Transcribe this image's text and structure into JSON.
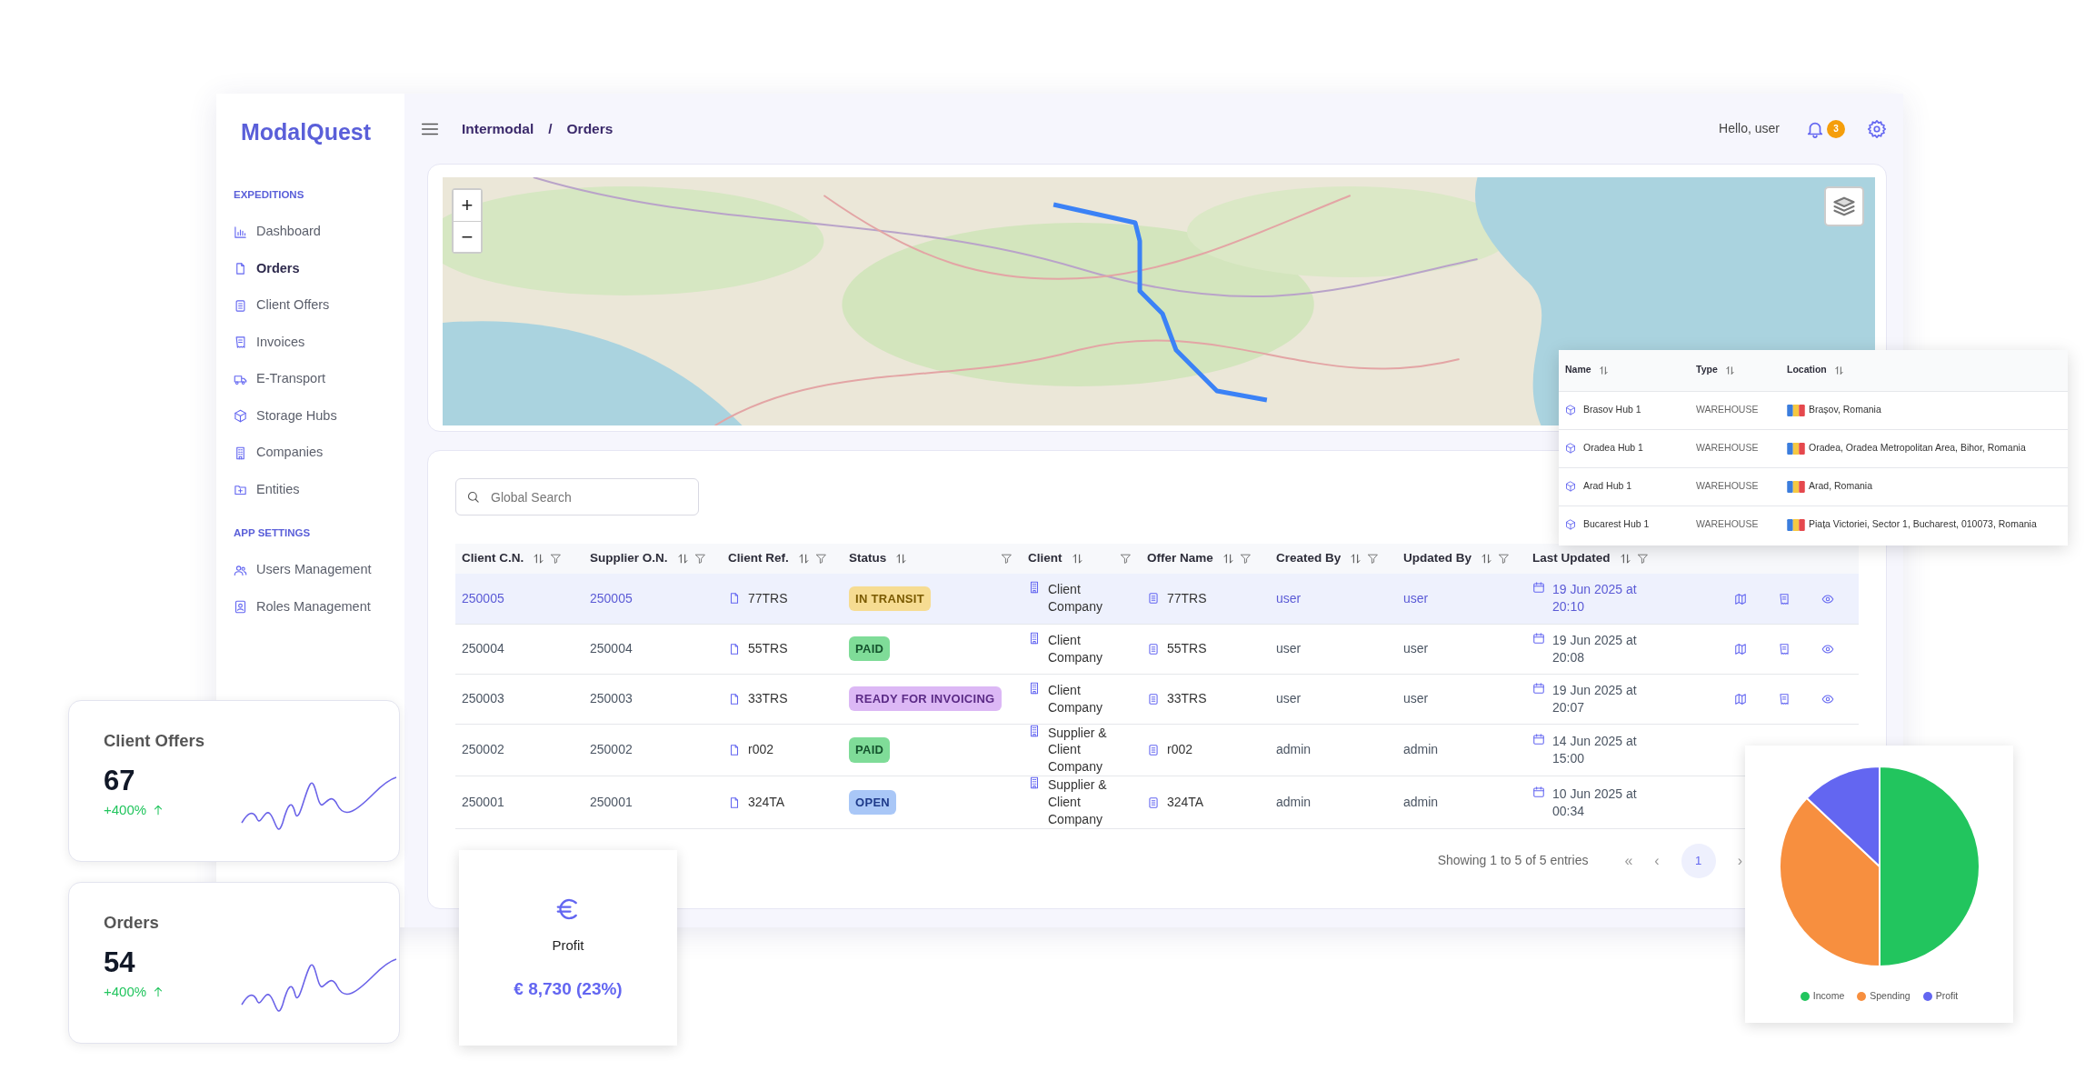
{
  "sidebar": {
    "logo": "ModalQuest",
    "sections": [
      {
        "heading": "EXPEDITIONS",
        "items": [
          {
            "label": "Dashboard",
            "selected": false
          },
          {
            "label": "Orders",
            "selected": true
          },
          {
            "label": "Client Offers",
            "selected": false
          },
          {
            "label": "Invoices",
            "selected": false
          },
          {
            "label": "E-Transport",
            "selected": false
          },
          {
            "label": "Storage Hubs",
            "selected": false
          },
          {
            "label": "Companies",
            "selected": false
          },
          {
            "label": "Entities",
            "selected": false
          }
        ]
      },
      {
        "heading": "APP SETTINGS",
        "items": [
          {
            "label": "Users Management",
            "selected": false
          },
          {
            "label": "Roles Management",
            "selected": false
          }
        ]
      }
    ]
  },
  "header": {
    "breadcrumb": [
      "Intermodal",
      "Orders"
    ],
    "separator": "/",
    "greeting": "Hello, user",
    "notification_count": "3"
  },
  "map": {
    "zoom_in": "+",
    "zoom_out": "−"
  },
  "orders_table": {
    "search": {
      "placeholder": "Global Search"
    },
    "columns": [
      "Client C.N.",
      "Supplier O.N.",
      "Client Ref.",
      "Status",
      "Client",
      "Offer Name",
      "Created By",
      "Updated By",
      "Last Updated"
    ],
    "rows": [
      {
        "selected": true,
        "client_cn": "250005",
        "supplier_on": "250005",
        "client_ref": "77TRS",
        "status": {
          "label": "IN TRANSIT",
          "kind": "transit"
        },
        "client": "Client Company",
        "offer_name": "77TRS",
        "created_by": "user",
        "updated_by": "user",
        "last_updated": "19 Jun 2025 at 20:10",
        "actions_visible": true
      },
      {
        "selected": false,
        "client_cn": "250004",
        "supplier_on": "250004",
        "client_ref": "55TRS",
        "status": {
          "label": "PAID",
          "kind": "paid"
        },
        "client": "Client Company",
        "offer_name": "55TRS",
        "created_by": "user",
        "updated_by": "user",
        "last_updated": "19 Jun 2025 at 20:08",
        "actions_visible": true
      },
      {
        "selected": false,
        "client_cn": "250003",
        "supplier_on": "250003",
        "client_ref": "33TRS",
        "status": {
          "label": "READY FOR INVOICING",
          "kind": "ready"
        },
        "client": "Client Company",
        "offer_name": "33TRS",
        "created_by": "user",
        "updated_by": "user",
        "last_updated": "19 Jun 2025 at 20:07",
        "actions_visible": true
      },
      {
        "selected": false,
        "client_cn": "250002",
        "supplier_on": "250002",
        "client_ref": "r002",
        "status": {
          "label": "PAID",
          "kind": "paid"
        },
        "client": "Supplier & Client Company",
        "offer_name": "r002",
        "created_by": "admin",
        "updated_by": "admin",
        "last_updated": "14 Jun 2025 at 15:00",
        "actions_visible": false
      },
      {
        "selected": false,
        "client_cn": "250001",
        "supplier_on": "250001",
        "client_ref": "324TA",
        "status": {
          "label": "OPEN",
          "kind": "open"
        },
        "client": "Supplier & Client Company",
        "offer_name": "324TA",
        "created_by": "admin",
        "updated_by": "admin",
        "last_updated": "10 Jun 2025 at 00:34",
        "actions_visible": false
      }
    ],
    "pagination": {
      "summary": "Showing 1 to 5 of 5 entries",
      "first": "«",
      "prev": "‹",
      "pages": [
        {
          "label": "1",
          "selected": true
        }
      ],
      "next": "›"
    }
  },
  "hubs_table": {
    "columns": [
      "Name",
      "Type",
      "Location"
    ],
    "rows": [
      {
        "name": "Brasov Hub 1",
        "type": "WAREHOUSE",
        "location": "Brașov, Romania"
      },
      {
        "name": "Oradea Hub 1",
        "type": "WAREHOUSE",
        "location": "Oradea, Oradea Metropolitan Area, Bihor, Romania"
      },
      {
        "name": "Arad Hub 1",
        "type": "WAREHOUSE",
        "location": "Arad, Romania"
      },
      {
        "name": "Bucarest Hub 1",
        "type": "WAREHOUSE",
        "location": "Piața Victoriei, Sector 1, Bucharest, 010073, Romania"
      }
    ]
  },
  "stat_cards": [
    {
      "title": "Client Offers",
      "value": "67",
      "change": "+400%"
    },
    {
      "title": "Orders",
      "value": "54",
      "change": "+400%"
    }
  ],
  "profit_card": {
    "title": "Profit",
    "value": "€ 8,730 (23%)"
  },
  "pie_card": {
    "chart_data": {
      "type": "pie",
      "categories": [
        "Income",
        "Spending",
        "Profit"
      ],
      "values": [
        50,
        37,
        13
      ]
    },
    "legend": [
      {
        "color": "#22c55e"
      },
      {
        "color": "#f78f3f"
      },
      {
        "color": "#6366f1"
      }
    ]
  }
}
